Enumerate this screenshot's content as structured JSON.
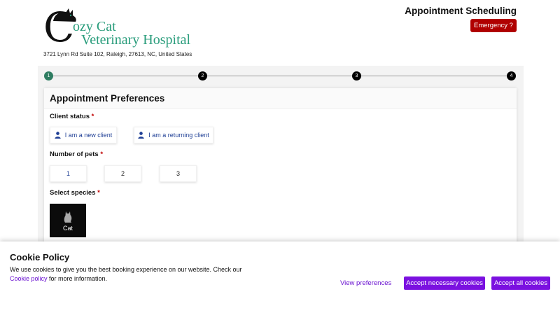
{
  "header": {
    "logo_c": "C",
    "logo_line1": "ozy Cat",
    "logo_line2": "Veterinary Hospital",
    "address": "3721 Lynn Rd Suite 102, Raleigh, 27613, NC, United States",
    "title": "Appointment Scheduling",
    "emergency_label": "Emergency ?"
  },
  "stepper": {
    "steps": [
      "1",
      "2",
      "3",
      "4"
    ],
    "current_step": 1
  },
  "form": {
    "title": "Appointment Preferences",
    "required_mark": "*",
    "client_status": {
      "label": "Client status",
      "options": [
        "I am a new client",
        "I am a returning client"
      ]
    },
    "pets": {
      "label": "Number of pets",
      "options": [
        "1",
        "2",
        "3"
      ]
    },
    "species": {
      "label": "Select species",
      "options": [
        "Cat"
      ]
    }
  },
  "cookie": {
    "title": "Cookie Policy",
    "text_before": "We use cookies to give you the best booking experience on our website. Check our",
    "link_label": "Cookie policy",
    "text_after": " for more information.",
    "view_preferences_label": "View preferences",
    "accept_necessary_label": "Accept necessary cookies",
    "accept_all_label": "Accept all cookies"
  },
  "colors": {
    "brand_teal": "#2a9d7c",
    "emergency_red": "#b00000",
    "cookie_purple": "#7b11e0",
    "active_step": "#2f7d62"
  }
}
